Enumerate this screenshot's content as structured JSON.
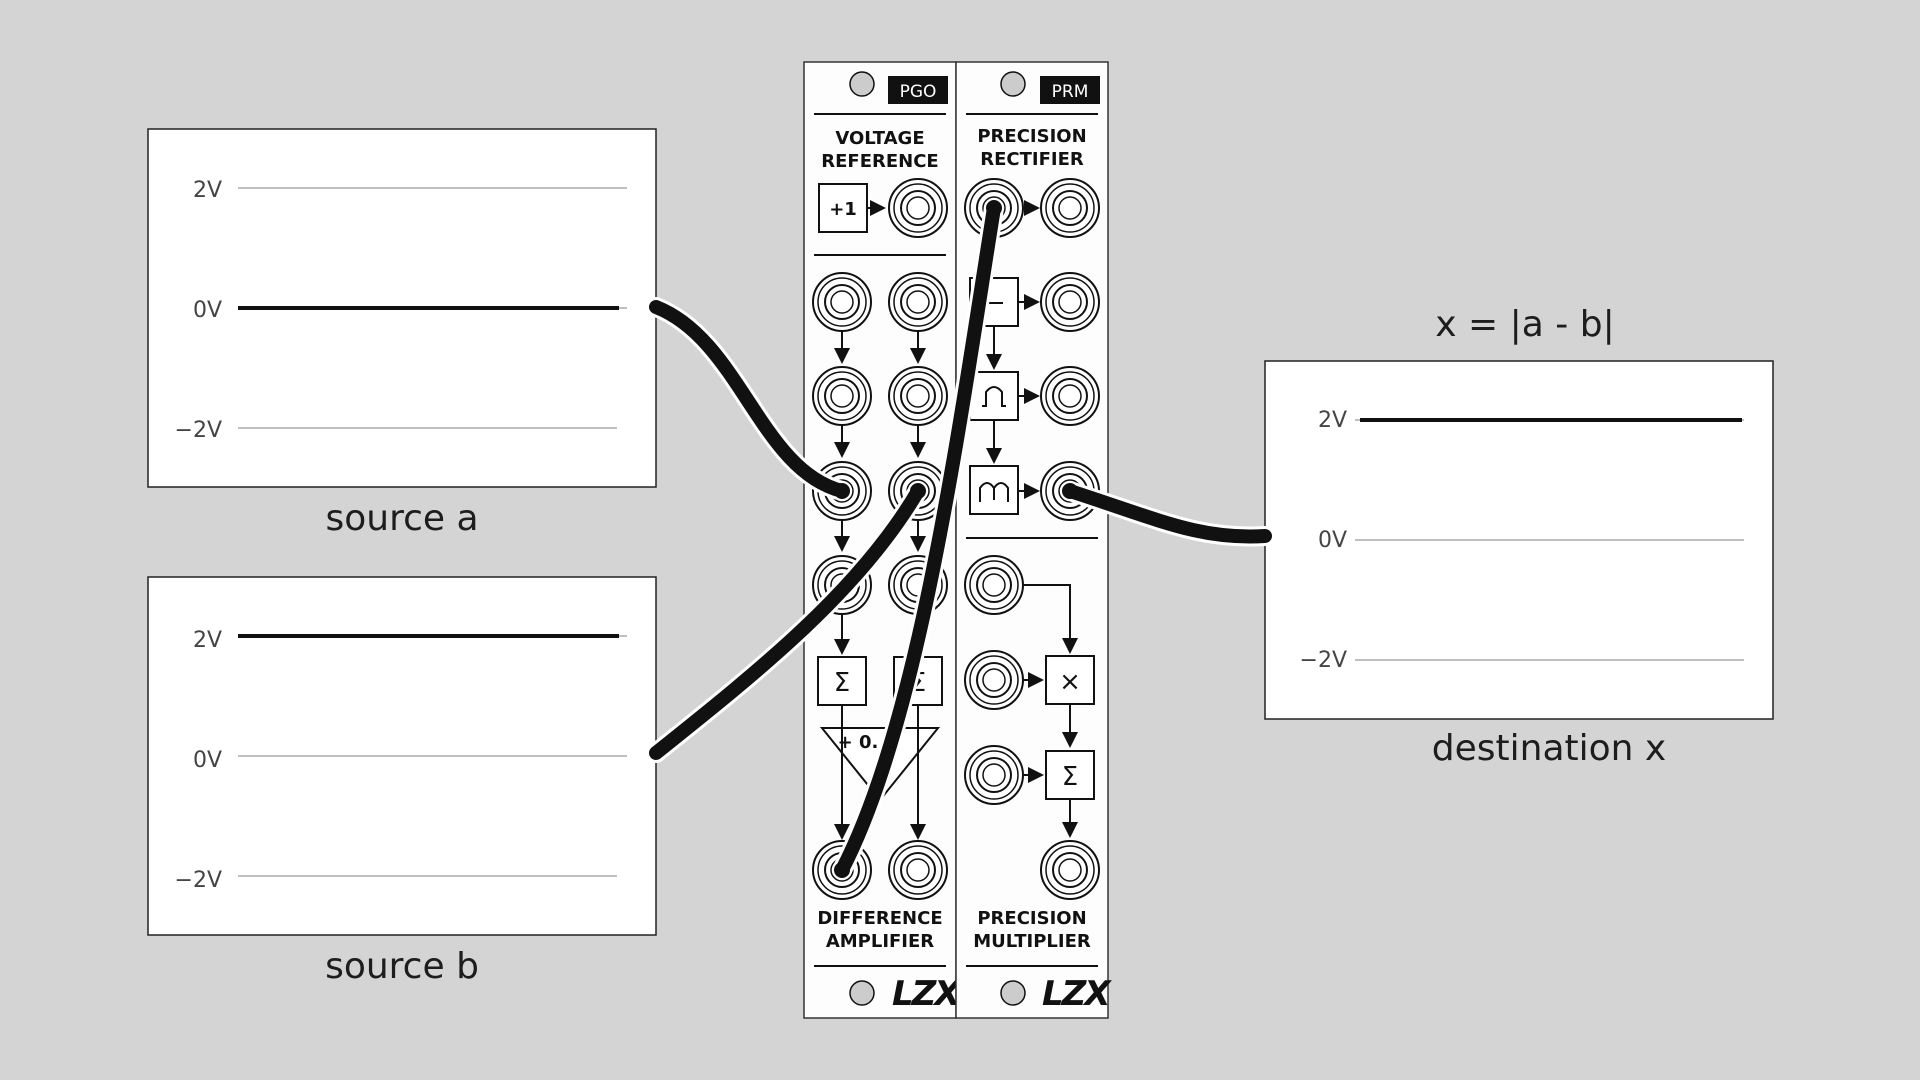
{
  "scopes": {
    "source_a": {
      "caption": "source a",
      "labels": [
        "2V",
        "0V",
        "−2V"
      ],
      "signal_voltage": 0
    },
    "source_b": {
      "caption": "source b",
      "labels": [
        "2V",
        "0V",
        "−2V"
      ],
      "signal_voltage": 2
    },
    "destination_x": {
      "caption": "destination x",
      "formula": "x = |a - b|",
      "labels": [
        "2V",
        "0V",
        "−2V"
      ],
      "signal_voltage": 2
    }
  },
  "modules": {
    "pgo": {
      "badge": "PGO",
      "title_top_line1": "VOLTAGE",
      "title_top_line2": "REFERENCE",
      "ref_label": "+1",
      "sum_symbol": "Σ",
      "gain_label": "+ 0.",
      "title_bottom_line1": "DIFFERENCE",
      "title_bottom_line2": "AMPLIFIER",
      "logo": "LZX"
    },
    "prm": {
      "badge": "PRM",
      "title_top_line1": "PRECISION",
      "title_top_line2": "RECTIFIER",
      "mult_symbol": "×",
      "sum_symbol": "Σ",
      "title_bottom_line1": "PRECISION",
      "title_bottom_line2": "MULTIPLIER",
      "logo": "LZX"
    }
  }
}
